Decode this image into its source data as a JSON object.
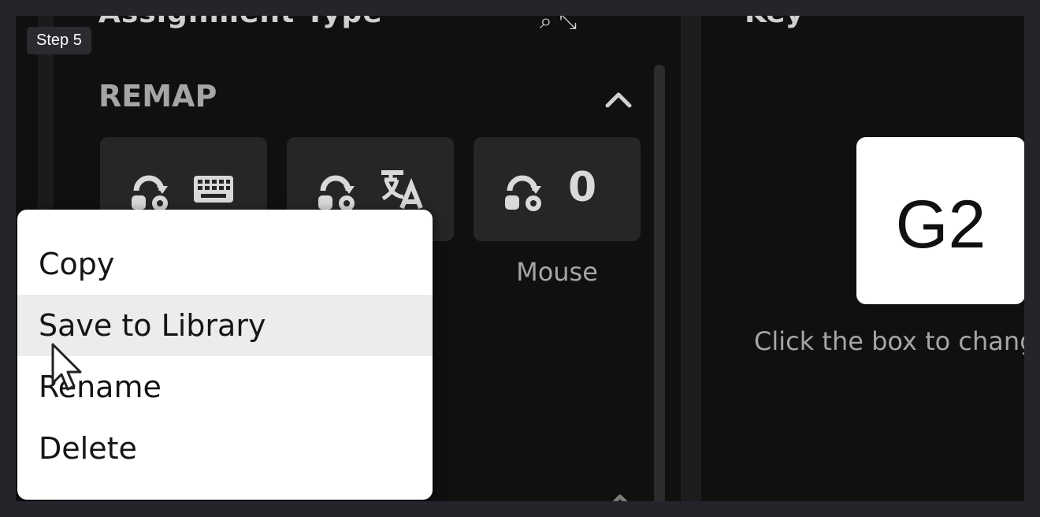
{
  "overlay": {
    "step_label": "Step 5"
  },
  "panel": {
    "heading": "Assignment Type",
    "section_label": "REMAP",
    "tiles": [
      {
        "label": "",
        "icon": "keyboard-icon"
      },
      {
        "label": "",
        "icon": "text-language-icon"
      },
      {
        "label": "Mouse",
        "icon": "mouse-zero-icon",
        "glyph": "0"
      }
    ]
  },
  "key_panel": {
    "heading": "Key",
    "key_value": "G2",
    "hint": "Click the box to change"
  },
  "context_menu": {
    "items": [
      {
        "label": "Copy"
      },
      {
        "label": "Save to Library",
        "hovered": true
      },
      {
        "label": "Rename"
      },
      {
        "label": "Delete"
      }
    ]
  },
  "colors": {
    "background": "#101010",
    "tile": "#262626",
    "menu": "#ffffff",
    "menu_hover": "#ececec",
    "muted_text": "#a5a5a5"
  }
}
